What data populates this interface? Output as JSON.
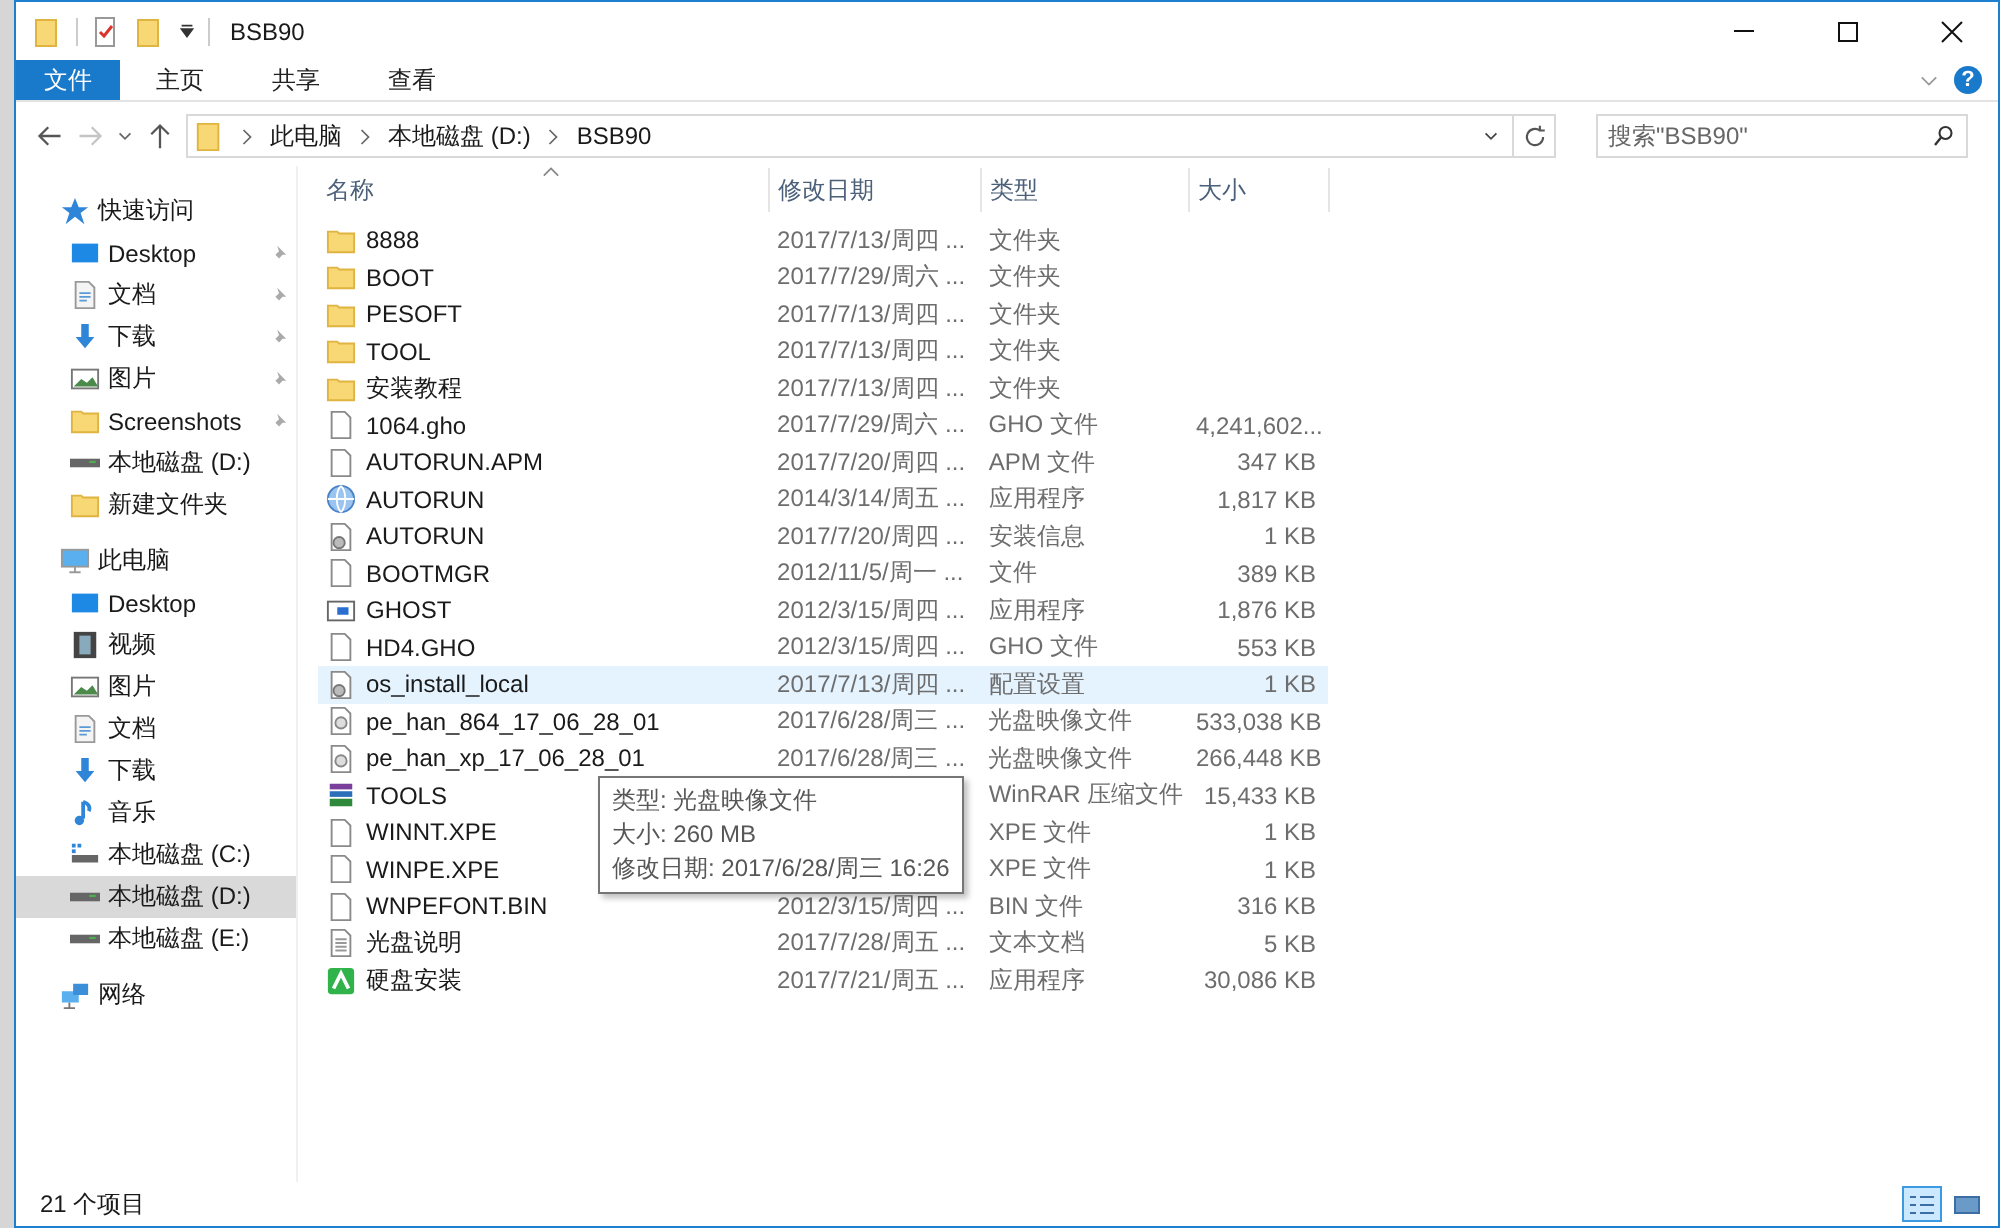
{
  "window": {
    "title": "BSB90"
  },
  "ribbon": {
    "tabs": [
      {
        "label": "文件",
        "selected": true
      },
      {
        "label": "主页",
        "selected": false
      },
      {
        "label": "共享",
        "selected": false
      },
      {
        "label": "查看",
        "selected": false
      }
    ],
    "help": "?"
  },
  "address": {
    "back_disabled": false,
    "forward_disabled": true,
    "crumbs": [
      "此电脑",
      "本地磁盘 (D:)",
      "BSB90"
    ]
  },
  "search": {
    "placeholder": "搜索\"BSB90\""
  },
  "sidebar": {
    "groups": [
      {
        "label": "快速访问",
        "kind": "star",
        "children": [
          {
            "label": "Desktop",
            "kind": "desktop",
            "pinned": true,
            "selected": false
          },
          {
            "label": "文档",
            "kind": "document",
            "pinned": true,
            "selected": false
          },
          {
            "label": "下载",
            "kind": "download",
            "pinned": true,
            "selected": false
          },
          {
            "label": "图片",
            "kind": "picture",
            "pinned": true,
            "selected": false
          },
          {
            "label": "Screenshots",
            "kind": "folder",
            "pinned": true,
            "selected": false
          },
          {
            "label": "本地磁盘 (D:)",
            "kind": "drive",
            "pinned": false,
            "selected": false
          },
          {
            "label": "新建文件夹",
            "kind": "folder",
            "pinned": false,
            "selected": false
          }
        ]
      },
      {
        "label": "此电脑",
        "kind": "pc",
        "children": [
          {
            "label": "Desktop",
            "kind": "desktop",
            "pinned": false,
            "selected": false
          },
          {
            "label": "视频",
            "kind": "video",
            "pinned": false,
            "selected": false
          },
          {
            "label": "图片",
            "kind": "picture",
            "pinned": false,
            "selected": false
          },
          {
            "label": "文档",
            "kind": "document",
            "pinned": false,
            "selected": false
          },
          {
            "label": "下载",
            "kind": "download",
            "pinned": false,
            "selected": false
          },
          {
            "label": "音乐",
            "kind": "music",
            "pinned": false,
            "selected": false
          },
          {
            "label": "本地磁盘 (C:)",
            "kind": "system-drive",
            "pinned": false,
            "selected": false
          },
          {
            "label": "本地磁盘 (D:)",
            "kind": "drive",
            "pinned": false,
            "selected": true
          },
          {
            "label": "本地磁盘 (E:)",
            "kind": "drive",
            "pinned": false,
            "selected": false
          }
        ]
      },
      {
        "label": "网络",
        "kind": "network"
      }
    ]
  },
  "table": {
    "columns": [
      "名称",
      "修改日期",
      "类型",
      "大小"
    ],
    "rows": [
      {
        "kind": "folder",
        "name": "8888",
        "date": "2017/7/13/周四 ...",
        "type": "文件夹",
        "highlighted": false
      },
      {
        "kind": "folder",
        "name": "BOOT",
        "date": "2017/7/29/周六 ...",
        "type": "文件夹",
        "highlighted": false
      },
      {
        "kind": "folder",
        "name": "PESOFT",
        "date": "2017/7/13/周四 ...",
        "type": "文件夹",
        "highlighted": false
      },
      {
        "kind": "folder",
        "name": "TOOL",
        "date": "2017/7/13/周四 ...",
        "type": "文件夹",
        "highlighted": false
      },
      {
        "kind": "folder",
        "name": "安装教程",
        "date": "2017/7/13/周四 ...",
        "type": "文件夹",
        "highlighted": false
      },
      {
        "kind": "file",
        "name": "1064.gho",
        "date": "2017/7/29/周六 ...",
        "type": "GHO 文件",
        "size": "4,241,602...",
        "highlighted": false
      },
      {
        "kind": "file",
        "name": "AUTORUN.APM",
        "date": "2017/7/20/周四 ...",
        "type": "APM 文件",
        "size": "347 KB",
        "highlighted": false
      },
      {
        "kind": "globe-app",
        "name": "AUTORUN",
        "date": "2014/3/14/周五 ...",
        "type": "应用程序",
        "size": "1,817 KB",
        "highlighted": false
      },
      {
        "kind": "settings-file",
        "name": "AUTORUN",
        "date": "2017/7/20/周四 ...",
        "type": "安装信息",
        "size": "1 KB",
        "highlighted": false
      },
      {
        "kind": "file",
        "name": "BOOTMGR",
        "date": "2012/11/5/周一 ...",
        "type": "文件",
        "size": "389 KB",
        "highlighted": false
      },
      {
        "kind": "window-app",
        "name": "GHOST",
        "date": "2012/3/15/周四 ...",
        "type": "应用程序",
        "size": "1,876 KB",
        "highlighted": false
      },
      {
        "kind": "file",
        "name": "HD4.GHO",
        "date": "2012/3/15/周四 ...",
        "type": "GHO 文件",
        "size": "553 KB",
        "highlighted": false
      },
      {
        "kind": "settings-file",
        "name": "os_install_local",
        "date": "2017/7/13/周四 ...",
        "type": "配置设置",
        "size": "1 KB",
        "highlighted": true
      },
      {
        "kind": "disc-file",
        "name": "pe_han_864_17_06_28_01",
        "date": "2017/6/28/周三 ...",
        "type": "光盘映像文件",
        "size": "533,038 KB",
        "highlighted": false
      },
      {
        "kind": "disc-file",
        "name": "pe_han_xp_17_06_28_01",
        "date": "2017/6/28/周三 ...",
        "type": "光盘映像文件",
        "size": "266,448 KB",
        "highlighted": false
      },
      {
        "kind": "archive",
        "name": "TOOLS",
        "type": "WinRAR 压缩文件",
        "size": "15,433 KB",
        "highlighted": false
      },
      {
        "kind": "file",
        "name": "WINNT.XPE",
        "type": "XPE 文件",
        "size": "1 KB",
        "highlighted": false
      },
      {
        "kind": "file",
        "name": "WINPE.XPE",
        "type": "XPE 文件",
        "size": "1 KB",
        "highlighted": false
      },
      {
        "kind": "file",
        "name": "WNPEFONT.BIN",
        "date": "2012/3/15/周四 ...",
        "type": "BIN 文件",
        "size": "316 KB",
        "highlighted": false
      },
      {
        "kind": "text-file",
        "name": "光盘说明",
        "date": "2017/7/28/周五 ...",
        "type": "文本文档",
        "size": "5 KB",
        "highlighted": false
      },
      {
        "kind": "green-app",
        "name": "硬盘安装",
        "date": "2017/7/21/周五 ...",
        "type": "应用程序",
        "size": "30,086 KB",
        "highlighted": false
      }
    ]
  },
  "tooltip": {
    "lines": [
      "类型: 光盘映像文件",
      "大小: 260 MB",
      "修改日期: 2017/6/28/周三 16:26"
    ]
  },
  "status_bar": {
    "count": "21 个项目",
    "views": [
      {
        "kind": "details",
        "selected": true
      },
      {
        "kind": "large-icons",
        "selected": false
      }
    ]
  }
}
